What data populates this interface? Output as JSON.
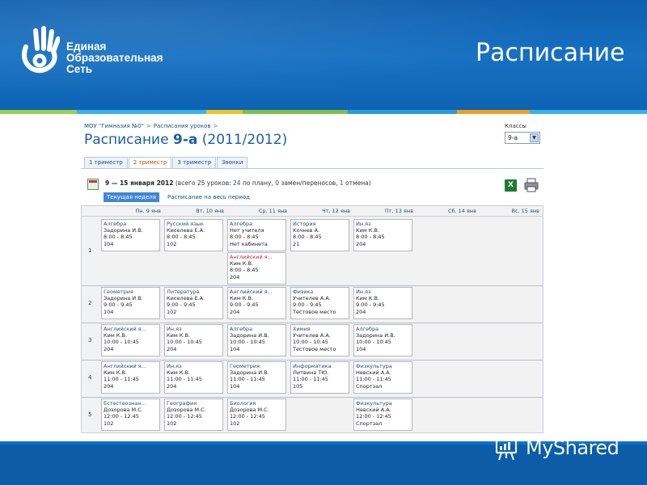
{
  "banner": {
    "logo_lines": [
      "Единая",
      "Образовательная",
      "Сеть"
    ],
    "slide_title": "Расписание",
    "stripe_colors": [
      "#9bd14b",
      "#3bb2e6",
      "#f2c31b",
      "#7fc241",
      "#2b9cd8",
      "#f0a020",
      "#38b3e5"
    ]
  },
  "breadcrumb": [
    "МОУ \"Гимназия №0\"",
    "Расписания уроков"
  ],
  "breadcrumb_sep": ">",
  "heading": {
    "prefix": "Расписание",
    "class": "9-а",
    "year": "(2011/2012)"
  },
  "classes": {
    "label": "Классы",
    "selected": "9-а"
  },
  "tabs": [
    {
      "label": "1 триместр",
      "active": false
    },
    {
      "label": "2 триместр",
      "active": true
    },
    {
      "label": "3 триместр",
      "active": false
    },
    {
      "label": "Звонки",
      "active": false
    }
  ],
  "week": {
    "range": "9 — 15 января 2012",
    "summary_a": "(всего 25 уроков: ",
    "planned": "24",
    "summary_b": " по плану, ",
    "replacements": "0",
    "summary_c": " замен/переносов, ",
    "cancelled": "1",
    "summary_d": " отмена)"
  },
  "subtabs": [
    {
      "label": "Текущая неделя",
      "active": true
    },
    {
      "label": "Расписание на весь период",
      "active": false
    }
  ],
  "days": [
    "Пн, 9 янв",
    "Вт, 10 янв",
    "Ср, 11 янв",
    "Чт, 12 янв",
    "Пт, 13 янв",
    "Сб, 14 янв",
    "Вс, 15 янв"
  ],
  "lessons": [
    {
      "num": "1",
      "cells": [
        [
          {
            "subject": "Алгебра",
            "teacher": "Задорина И.В.",
            "time": "8:00 - 8:45",
            "room": "104"
          }
        ],
        [
          {
            "subject": "Русский язык",
            "teacher": "Киселева Е.А.",
            "time": "8:00 - 8:45",
            "room": "102"
          }
        ],
        [
          {
            "subject": "Алгебра",
            "teacher": "Нет учителя",
            "time": "8:00 - 8:45",
            "room": "Нет кабинета"
          },
          {
            "subject": "Английский я...",
            "teacher": "Ким К.В.",
            "time": "8:00 - 8:45",
            "room": "204",
            "cancelled": true
          }
        ],
        [
          {
            "subject": "История",
            "teacher": "Кочнев А.",
            "time": "8:00 - 8:45",
            "room": "21"
          }
        ],
        [
          {
            "subject": "Ин.яз",
            "teacher": "Ким К.В.",
            "time": "8:00 - 8:45",
            "room": "204"
          }
        ],
        [],
        []
      ]
    },
    {
      "num": "2",
      "cells": [
        [
          {
            "subject": "Геометрия",
            "teacher": "Задорина И.В.",
            "time": "9:00 - 9:45",
            "room": "104"
          }
        ],
        [
          {
            "subject": "Литература",
            "teacher": "Киселева Е.А.",
            "time": "9:00 - 9:45",
            "room": "102"
          }
        ],
        [
          {
            "subject": "Английский я...",
            "teacher": "Ким К.В.",
            "time": "9:00 - 9:45",
            "room": "204"
          }
        ],
        [
          {
            "subject": "Физика",
            "teacher": "Учителев А.А.",
            "time": "9:00 - 9:45",
            "room": "Тестовое место"
          }
        ],
        [
          {
            "subject": "Ин.яз",
            "teacher": "Ким К.В.",
            "time": "9:00 - 9:45",
            "room": "204"
          }
        ],
        [],
        []
      ]
    },
    {
      "num": "3",
      "cells": [
        [
          {
            "subject": "Английский я...",
            "teacher": "Ким К.В.",
            "time": "10:00 - 10:45",
            "room": "204"
          }
        ],
        [
          {
            "subject": "Ин.яз",
            "teacher": "Ким К.В.",
            "time": "10:00 - 10:45",
            "room": "204"
          }
        ],
        [
          {
            "subject": "Алгебра",
            "teacher": "Задорина И.В.",
            "time": "10:00 - 10:45",
            "room": "104"
          }
        ],
        [
          {
            "subject": "Химия",
            "teacher": "Учителев А.А.",
            "time": "10:00 - 10:45",
            "room": "Тестовое место"
          }
        ],
        [
          {
            "subject": "Алгебра",
            "teacher": "Задорина И.В.",
            "time": "10:00 - 10:45",
            "room": "104"
          }
        ],
        [],
        []
      ]
    },
    {
      "num": "4",
      "cells": [
        [
          {
            "subject": "Английский я...",
            "teacher": "Ким К.В.",
            "time": "11:00 - 11:45",
            "room": "204"
          }
        ],
        [
          {
            "subject": "Ин.яз",
            "teacher": "Ким К.В.",
            "time": "11:00 - 11:45",
            "room": "204"
          }
        ],
        [
          {
            "subject": "Геометрия",
            "teacher": "Задорина И.В.",
            "time": "11:00 - 11:45",
            "room": "104"
          }
        ],
        [
          {
            "subject": "Информатика",
            "teacher": "Литвина ТЮ.",
            "time": "11:00 - 11:45",
            "room": "105"
          }
        ],
        [
          {
            "subject": "Физкультура",
            "teacher": "Невский А.А.",
            "time": "11:00 - 11:45",
            "room": "Спортзал"
          }
        ],
        [],
        []
      ]
    },
    {
      "num": "5",
      "cells": [
        [
          {
            "subject": "Естествознан...",
            "teacher": "Дозорова М.С.",
            "time": "12:00 - 12:45",
            "room": "102"
          }
        ],
        [
          {
            "subject": "География",
            "teacher": "Дозорова М.С.",
            "time": "12:00 - 12:45",
            "room": "102"
          }
        ],
        [
          {
            "subject": "Биология",
            "teacher": "Дозорова М.С.",
            "time": "12:00 - 12:45",
            "room": "102"
          }
        ],
        [],
        [
          {
            "subject": "Физкультура",
            "teacher": "Невский А.А.",
            "time": "12:00 - 12:45",
            "room": "Спортзал"
          }
        ],
        [],
        []
      ]
    }
  ],
  "watermark": {
    "text": "MyShared"
  },
  "colors": {
    "banner": "#1670c2",
    "link": "#1a4f8f",
    "active_tab": "#c45400",
    "cancelled": "#c62828",
    "subtab_active": "#3f86d6"
  }
}
